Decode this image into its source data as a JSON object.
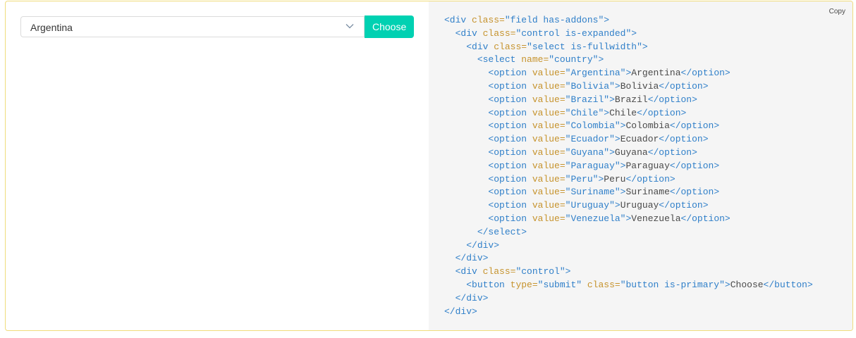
{
  "form": {
    "selected_country": "Argentina",
    "choose_label": "Choose",
    "chevron_icon": "chevron-down-icon",
    "accent_color": "#00d1b2"
  },
  "code_panel": {
    "copy_label": "Copy",
    "lines": [
      [
        [
          "0",
          "t",
          "<div "
        ],
        [
          "a",
          "class="
        ],
        [
          "s",
          "\"field has-addons\""
        ],
        [
          "t",
          ">"
        ]
      ],
      [
        [
          "1",
          "t",
          "<div "
        ],
        [
          "a",
          "class="
        ],
        [
          "s",
          "\"control is-expanded\""
        ],
        [
          "t",
          ">"
        ]
      ],
      [
        [
          "2",
          "t",
          "<div "
        ],
        [
          "a",
          "class="
        ],
        [
          "s",
          "\"select is-fullwidth\""
        ],
        [
          "t",
          ">"
        ]
      ],
      [
        [
          "3",
          "t",
          "<select "
        ],
        [
          "a",
          "name="
        ],
        [
          "s",
          "\"country\""
        ],
        [
          "t",
          ">"
        ]
      ],
      [
        [
          "4",
          "t",
          "<option "
        ],
        [
          "a",
          "value="
        ],
        [
          "s",
          "\"Argentina\""
        ],
        [
          "t",
          ">"
        ],
        [
          "x",
          "Argentina"
        ],
        [
          "t",
          "</option>"
        ]
      ],
      [
        [
          "4",
          "t",
          "<option "
        ],
        [
          "a",
          "value="
        ],
        [
          "s",
          "\"Bolivia\""
        ],
        [
          "t",
          ">"
        ],
        [
          "x",
          "Bolivia"
        ],
        [
          "t",
          "</option>"
        ]
      ],
      [
        [
          "4",
          "t",
          "<option "
        ],
        [
          "a",
          "value="
        ],
        [
          "s",
          "\"Brazil\""
        ],
        [
          "t",
          ">"
        ],
        [
          "x",
          "Brazil"
        ],
        [
          "t",
          "</option>"
        ]
      ],
      [
        [
          "4",
          "t",
          "<option "
        ],
        [
          "a",
          "value="
        ],
        [
          "s",
          "\"Chile\""
        ],
        [
          "t",
          ">"
        ],
        [
          "x",
          "Chile"
        ],
        [
          "t",
          "</option>"
        ]
      ],
      [
        [
          "4",
          "t",
          "<option "
        ],
        [
          "a",
          "value="
        ],
        [
          "s",
          "\"Colombia\""
        ],
        [
          "t",
          ">"
        ],
        [
          "x",
          "Colombia"
        ],
        [
          "t",
          "</option>"
        ]
      ],
      [
        [
          "4",
          "t",
          "<option "
        ],
        [
          "a",
          "value="
        ],
        [
          "s",
          "\"Ecuador\""
        ],
        [
          "t",
          ">"
        ],
        [
          "x",
          "Ecuador"
        ],
        [
          "t",
          "</option>"
        ]
      ],
      [
        [
          "4",
          "t",
          "<option "
        ],
        [
          "a",
          "value="
        ],
        [
          "s",
          "\"Guyana\""
        ],
        [
          "t",
          ">"
        ],
        [
          "x",
          "Guyana"
        ],
        [
          "t",
          "</option>"
        ]
      ],
      [
        [
          "4",
          "t",
          "<option "
        ],
        [
          "a",
          "value="
        ],
        [
          "s",
          "\"Paraguay\""
        ],
        [
          "t",
          ">"
        ],
        [
          "x",
          "Paraguay"
        ],
        [
          "t",
          "</option>"
        ]
      ],
      [
        [
          "4",
          "t",
          "<option "
        ],
        [
          "a",
          "value="
        ],
        [
          "s",
          "\"Peru\""
        ],
        [
          "t",
          ">"
        ],
        [
          "x",
          "Peru"
        ],
        [
          "t",
          "</option>"
        ]
      ],
      [
        [
          "4",
          "t",
          "<option "
        ],
        [
          "a",
          "value="
        ],
        [
          "s",
          "\"Suriname\""
        ],
        [
          "t",
          ">"
        ],
        [
          "x",
          "Suriname"
        ],
        [
          "t",
          "</option>"
        ]
      ],
      [
        [
          "4",
          "t",
          "<option "
        ],
        [
          "a",
          "value="
        ],
        [
          "s",
          "\"Uruguay\""
        ],
        [
          "t",
          ">"
        ],
        [
          "x",
          "Uruguay"
        ],
        [
          "t",
          "</option>"
        ]
      ],
      [
        [
          "4",
          "t",
          "<option "
        ],
        [
          "a",
          "value="
        ],
        [
          "s",
          "\"Venezuela\""
        ],
        [
          "t",
          ">"
        ],
        [
          "x",
          "Venezuela"
        ],
        [
          "t",
          "</option>"
        ]
      ],
      [
        [
          "3",
          "t",
          "</select>"
        ]
      ],
      [
        [
          "2",
          "t",
          "</div>"
        ]
      ],
      [
        [
          "1",
          "t",
          "</div>"
        ]
      ],
      [
        [
          "1",
          "t",
          "<div "
        ],
        [
          "a",
          "class="
        ],
        [
          "s",
          "\"control\""
        ],
        [
          "t",
          ">"
        ]
      ],
      [
        [
          "2",
          "t",
          "<button "
        ],
        [
          "a",
          "type="
        ],
        [
          "s",
          "\"submit\" "
        ],
        [
          "a",
          "class="
        ],
        [
          "s",
          "\"button is-primary\""
        ],
        [
          "t",
          ">"
        ],
        [
          "x",
          "Choose"
        ],
        [
          "t",
          "</button>"
        ]
      ],
      [
        [
          "1",
          "t",
          "</div>"
        ]
      ],
      [
        [
          "0",
          "t",
          "</div>"
        ]
      ]
    ]
  }
}
